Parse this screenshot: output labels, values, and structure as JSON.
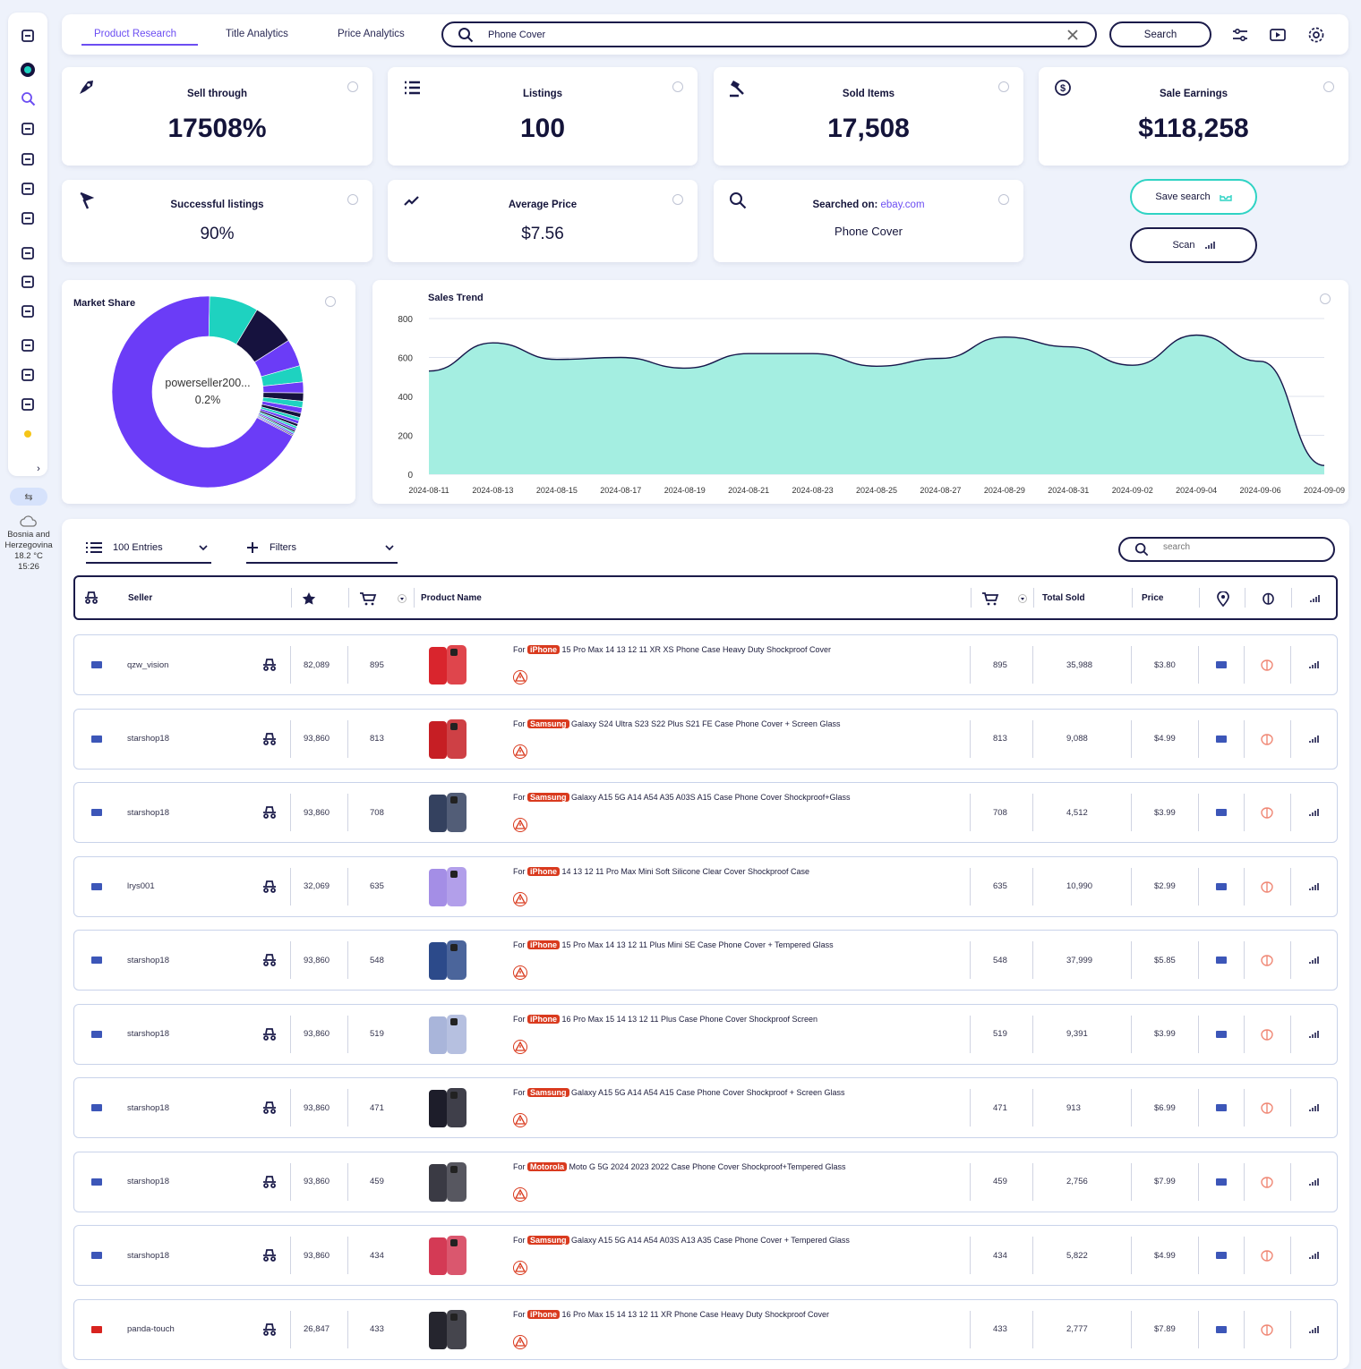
{
  "nav": {
    "tabs": [
      "Product Research",
      "Title Analytics",
      "Price Analytics"
    ],
    "search_value": "Phone Cover",
    "search_button": "Search"
  },
  "sidebar": {
    "icons": [
      "swap-icon",
      "logo-icon",
      "search-magnify-icon",
      "spy-icon",
      "network-icon",
      "frame-icon",
      "diamond-icon",
      "users-icon",
      "store-icon",
      "hand-icon",
      "wrench-icon",
      "gear-icon",
      "logout-icon",
      "sun-icon"
    ],
    "weather": {
      "location_line1": "Bosnia and",
      "location_line2": "Herzegovina",
      "temp": "18.2 °C",
      "time": "15:26"
    }
  },
  "stats": [
    {
      "label": "Sell through",
      "value": "17508%"
    },
    {
      "label": "Listings",
      "value": "100"
    },
    {
      "label": "Sold Items",
      "value": "17,508"
    },
    {
      "label": "Sale Earnings",
      "value": "$118,258"
    },
    {
      "label": "Successful listings",
      "value": "90%"
    },
    {
      "label": "Average Price",
      "value": "$7.56"
    },
    {
      "label_prefix": "Searched on: ",
      "label_link": "ebay.com",
      "value": "Phone Cover"
    }
  ],
  "actions": {
    "save": "Save search",
    "scan": "Scan"
  },
  "market_share": {
    "title": "Market Share",
    "center_name": "powerseller200...",
    "center_value": "0.2%",
    "colors": {
      "main": "#6b3cf7",
      "teal": "#1ed2c0",
      "dark": "#16123e"
    }
  },
  "chart_data": {
    "type": "area",
    "title": "Sales Trend",
    "x": [
      "2024-08-11",
      "2024-08-13",
      "2024-08-15",
      "2024-08-17",
      "2024-08-19",
      "2024-08-21",
      "2024-08-23",
      "2024-08-25",
      "2024-08-27",
      "2024-08-29",
      "2024-08-31",
      "2024-09-02",
      "2024-09-04",
      "2024-09-06",
      "2024-09-09"
    ],
    "values": [
      530,
      675,
      590,
      600,
      545,
      620,
      620,
      555,
      595,
      705,
      655,
      560,
      715,
      580,
      45
    ],
    "ylim": [
      0,
      800
    ],
    "yticks": [
      0,
      200,
      400,
      600,
      800
    ],
    "fill": "#a4eee1",
    "stroke": "#16164a",
    "grid": true
  },
  "table": {
    "entries_label": "100 Entries",
    "filters_label": "Filters",
    "search_placeholder": "search",
    "headers": {
      "seller": "Seller",
      "product": "Product Name",
      "total_sold": "Total Sold",
      "price": "Price"
    },
    "rows": [
      {
        "flag": "us",
        "seller": "qzw_vision",
        "rating": "82,089",
        "sold": "895",
        "brand": "iPhone",
        "title": "15 Pro Max 14 13 12 11 XR XS Phone Case Heavy Duty Shockproof Cover",
        "sold2": "895",
        "total": "35,988",
        "price": "$3.80",
        "thumb": "#d9252d"
      },
      {
        "flag": "us",
        "seller": "starshop18",
        "rating": "93,860",
        "sold": "813",
        "brand": "Samsung",
        "title": "Galaxy S24 Ultra S23 S22 Plus S21 FE Case Phone Cover + Screen Glass",
        "sold2": "813",
        "total": "9,088",
        "price": "$4.99",
        "thumb": "#c61e24"
      },
      {
        "flag": "us",
        "seller": "starshop18",
        "rating": "93,860",
        "sold": "708",
        "brand": "Samsung",
        "title": "Galaxy A15 5G A14 A54 A35 A03S A15 Case Phone Cover Shockproof+Glass",
        "sold2": "708",
        "total": "4,512",
        "price": "$3.99",
        "thumb": "#34415f"
      },
      {
        "flag": "us",
        "seller": "lrys001",
        "rating": "32,069",
        "sold": "635",
        "brand": "iPhone",
        "title": "14 13 12 11 Pro Max Mini Soft Silicone Clear Cover Shockproof Case",
        "sold2": "635",
        "total": "10,990",
        "price": "$2.99",
        "thumb": "#a48ee6"
      },
      {
        "flag": "us",
        "seller": "starshop18",
        "rating": "93,860",
        "sold": "548",
        "brand": "iPhone",
        "title": "15 Pro Max 14 13 12 11 Plus Mini SE Case Phone Cover + Tempered Glass",
        "sold2": "548",
        "total": "37,999",
        "price": "$5.85",
        "thumb": "#2c4a8a"
      },
      {
        "flag": "us",
        "seller": "starshop18",
        "rating": "93,860",
        "sold": "519",
        "brand": "iPhone",
        "title": "16 Pro Max 15 14 13 12 11 Plus Case Phone Cover Shockproof Screen",
        "sold2": "519",
        "total": "9,391",
        "price": "$3.99",
        "thumb": "#a9b5da"
      },
      {
        "flag": "us",
        "seller": "starshop18",
        "rating": "93,860",
        "sold": "471",
        "brand": "Samsung",
        "title": "Galaxy A15 5G A14 A54 A15 Case Phone Cover Shockproof + Screen Glass",
        "sold2": "471",
        "total": "913",
        "price": "$6.99",
        "thumb": "#1d1d2a"
      },
      {
        "flag": "us",
        "seller": "starshop18",
        "rating": "93,860",
        "sold": "459",
        "brand": "Motorola",
        "title": "Moto G 5G 2024 2023 2022 Case Phone Cover Shockproof+Tempered Glass",
        "sold2": "459",
        "total": "2,756",
        "price": "$7.99",
        "thumb": "#3a3a44"
      },
      {
        "flag": "us",
        "seller": "starshop18",
        "rating": "93,860",
        "sold": "434",
        "brand": "Samsung",
        "title": "Galaxy A15 5G A14 A54 A03S A13 A35 Case Phone Cover + Tempered Glass",
        "sold2": "434",
        "total": "5,822",
        "price": "$4.99",
        "thumb": "#d43a55"
      },
      {
        "flag": "cn",
        "seller": "panda-touch",
        "rating": "26,847",
        "sold": "433",
        "brand": "iPhone",
        "title": "16 Pro Max 15 14 13 12 11 XR Phone Case Heavy Duty Shockproof Cover",
        "sold2": "433",
        "total": "2,777",
        "price": "$7.89",
        "thumb": "#25252e"
      }
    ]
  }
}
